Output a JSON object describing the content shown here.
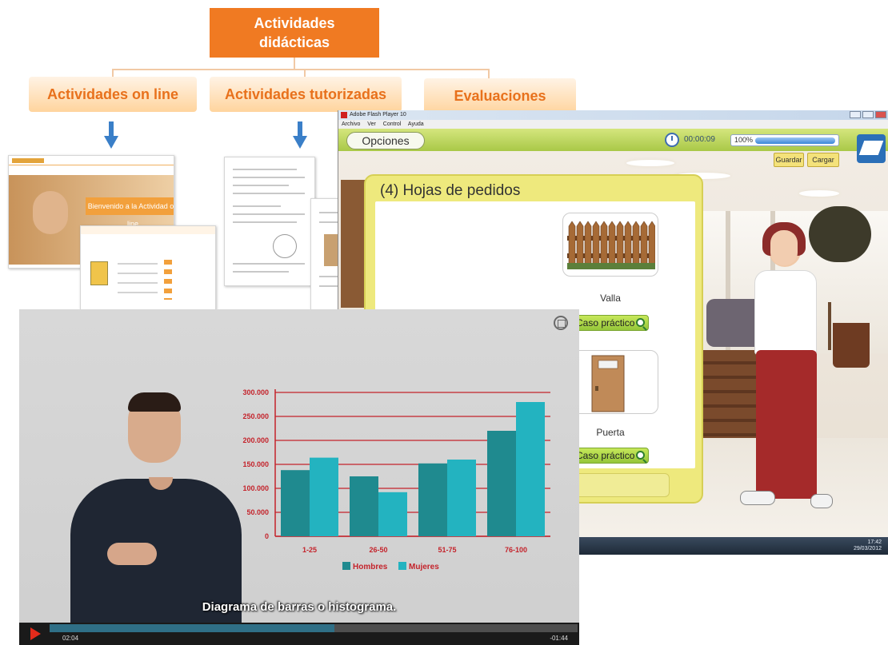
{
  "concept_map": {
    "root_title": "Actividades didácticas",
    "categories": [
      "Actividades on line",
      "Actividades tutorizadas",
      "Evaluaciones"
    ],
    "colors": {
      "root": "#f07a22",
      "category_text": "#e8711c",
      "arrow": "#3a7fc8"
    },
    "online_thumbnail": {
      "banner_text": "Bienvenido a la Actividad on line"
    }
  },
  "flash_window": {
    "title": "Adobe Flash Player 10",
    "menu": [
      "Archivo",
      "Ver",
      "Control",
      "Ayuda"
    ],
    "toolbar": {
      "options_label": "Opciones",
      "timer": "00:00:09",
      "progress_label": "100%",
      "progress_value": 1.0,
      "save_label": "Guardar",
      "load_label": "Cargar"
    },
    "panel": {
      "title": "(4) Hojas de pedidos",
      "items": [
        {
          "label": "Valla",
          "button": "Caso práctico"
        },
        {
          "label": "Puerta",
          "button": "Caso práctico"
        }
      ]
    },
    "clock": {
      "time": "17:42",
      "date": "29/03/2012"
    }
  },
  "video_player": {
    "subtitle": "Diagrama de barras o histograma.",
    "time_elapsed": "02:04",
    "time_remaining": "-01:44",
    "progress": 0.54,
    "colors": {
      "play": "#e42b1b",
      "seek_fill": "#2f6f86"
    }
  },
  "chart_data": {
    "type": "bar",
    "categories": [
      "1-25",
      "26-50",
      "51-75",
      "76-100"
    ],
    "series": [
      {
        "name": "Hombres",
        "values": [
          138000,
          125000,
          152000,
          220000
        ],
        "color": "#1f8a8f"
      },
      {
        "name": "Mujeres",
        "values": [
          164000,
          92000,
          160000,
          280000
        ],
        "color": "#23b3c0"
      }
    ],
    "ylim": [
      0,
      300000
    ],
    "yticks": [
      "0",
      "50.000",
      "100.000",
      "150.000",
      "200.000",
      "250.000",
      "300.000"
    ],
    "grid": true,
    "grid_color": "#c4232b",
    "legend_position": "bottom"
  }
}
